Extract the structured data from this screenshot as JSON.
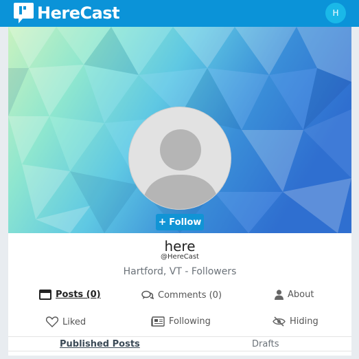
{
  "app": {
    "name": "HereCast",
    "user_initial": "H"
  },
  "profile": {
    "follow_label": "Follow",
    "name": "here",
    "handle": "@HereCast",
    "location_followers": "Hartford, VT - Followers"
  },
  "tabs": {
    "posts": "Posts (0)",
    "comments": "Comments (0)",
    "about": "About",
    "liked": "Liked",
    "following": "Following",
    "hiding": "Hiding"
  },
  "subtabs": {
    "published": "Published Posts",
    "drafts": "Drafts"
  },
  "colors": {
    "brand": "#0b93d8",
    "follow_button": "#1194d5",
    "avatar_bg": "#1ab8e8"
  },
  "icons": {
    "logo": "chat-bubble-logo-icon",
    "follow": "plus-icon",
    "posts": "window-icon",
    "comments": "comments-icon",
    "about": "user-icon",
    "liked": "heart-icon",
    "following": "newspaper-icon",
    "hiding": "eye-slash-icon"
  }
}
